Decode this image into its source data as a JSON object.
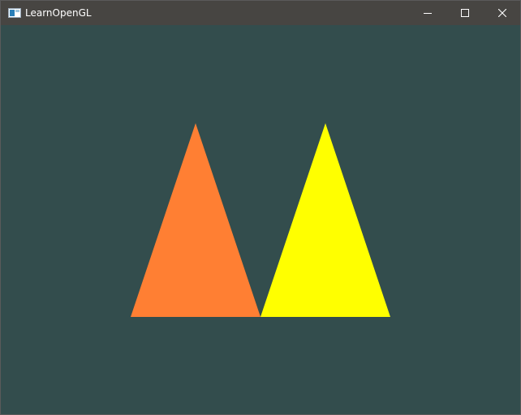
{
  "window": {
    "title": "LearnOpenGL",
    "clear_color": "#334d4d",
    "titlebar_color": "#474542"
  },
  "titlebar_buttons": {
    "minimize_icon": "minimize-icon",
    "maximize_icon": "maximize-icon",
    "close_icon": "close-icon"
  },
  "scene": {
    "triangles": [
      {
        "name": "orange-triangle",
        "color": "#ff7f33"
      },
      {
        "name": "yellow-triangle",
        "color": "#ffff00"
      }
    ]
  }
}
